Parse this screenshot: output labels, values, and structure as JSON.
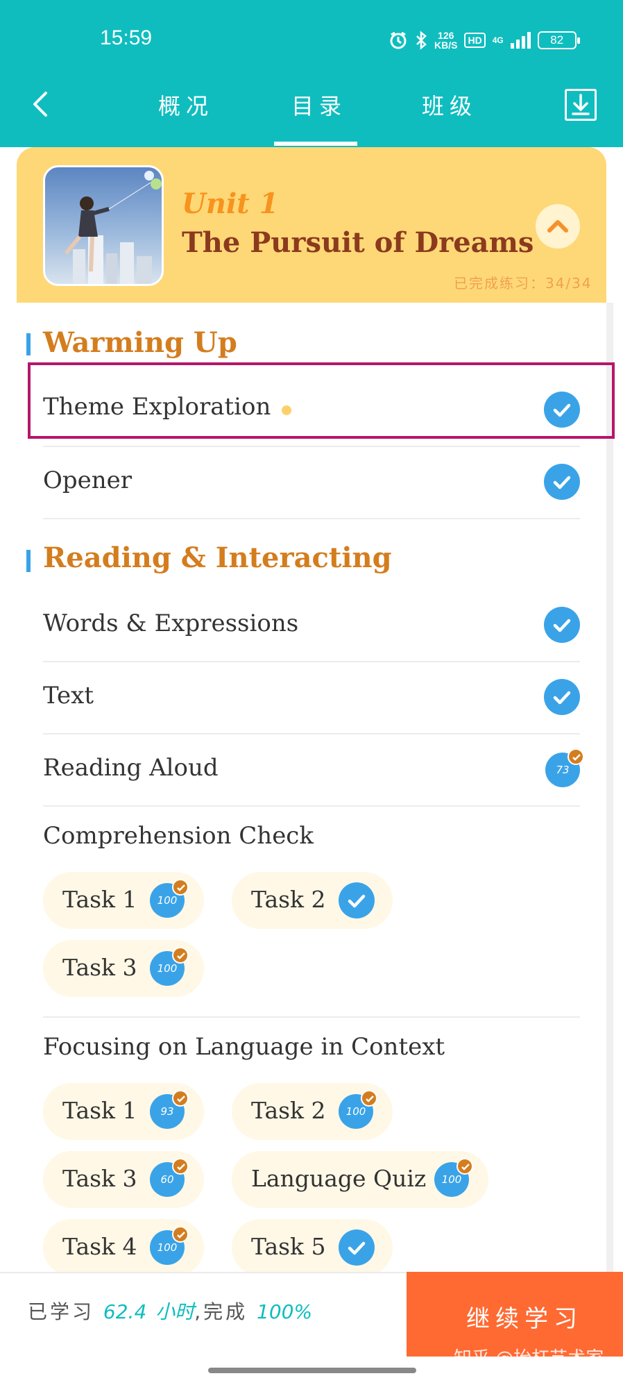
{
  "status_bar": {
    "time": "15:59",
    "net_speed_top": "126",
    "net_speed_bottom": "KB/S",
    "hd": "HD",
    "signal": "4G",
    "battery": "82"
  },
  "tabs": [
    {
      "label": "概况"
    },
    {
      "label": "目录"
    },
    {
      "label": "班级"
    }
  ],
  "unit": {
    "label": "Unit 1",
    "title": "The Pursuit of Dreams",
    "progress": "已完成练习：34/34"
  },
  "sections": [
    {
      "title": "Warming Up"
    },
    {
      "title": "Reading & Interacting"
    }
  ],
  "items": {
    "theme_exploration": "Theme Exploration",
    "opener": "Opener",
    "words_expressions": "Words & Expressions",
    "text": "Text",
    "reading_aloud": {
      "label": "Reading Aloud",
      "score": "73"
    },
    "comprehension_check": "Comprehension Check",
    "focusing_language": "Focusing on Language in Context"
  },
  "comprehension_tasks": [
    {
      "label": "Task 1",
      "score": "100"
    },
    {
      "label": "Task 2",
      "score": null
    },
    {
      "label": "Task 3",
      "score": "100"
    }
  ],
  "focusing_tasks": [
    {
      "label": "Task 1",
      "score": "93"
    },
    {
      "label": "Task 2",
      "score": "100"
    },
    {
      "label": "Task 3",
      "score": "60"
    },
    {
      "label": "Language Quiz",
      "score": "100"
    },
    {
      "label": "Task 4",
      "score": "100"
    },
    {
      "label": "Task 5",
      "score": null
    }
  ],
  "bottom": {
    "studied_prefix": "已学习",
    "hours": "62.4",
    "hours_unit": "小时",
    "completed_prefix": ",完成",
    "percent": "100%",
    "continue_label": "继续学习",
    "watermark": "知乎 @抬杠艺术家"
  },
  "colors": {
    "teal": "#0fbdbf",
    "accent_orange": "#ff6a32",
    "check_blue": "#3aa3e8",
    "section_orange": "#d47d1e"
  }
}
